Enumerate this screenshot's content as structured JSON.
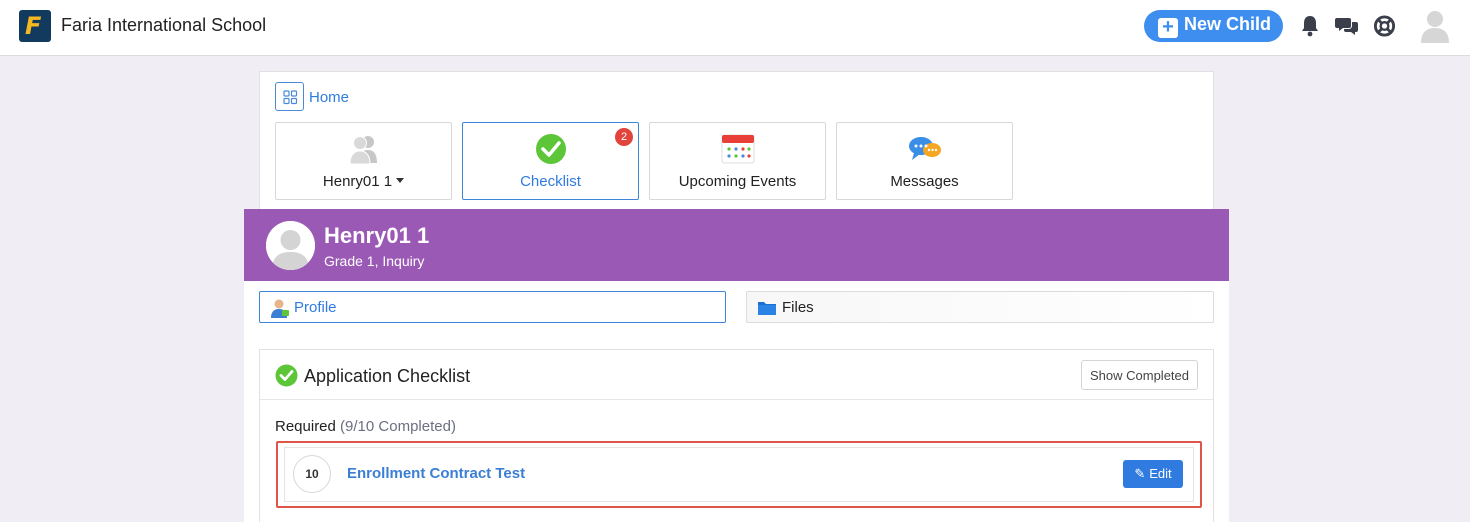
{
  "header": {
    "school_name": "Faria International School",
    "new_child_label": "New Child"
  },
  "home": {
    "link_label": "Home"
  },
  "tiles": [
    {
      "label": "Henry01 1",
      "icon": "users-icon"
    },
    {
      "label": "Checklist",
      "icon": "check-circle-icon",
      "badge": "2"
    },
    {
      "label": "Upcoming Events",
      "icon": "calendar-icon"
    },
    {
      "label": "Messages",
      "icon": "chat-bubbles-icon"
    }
  ],
  "child": {
    "name": "Henry01 1",
    "grade": "Grade 1, Inquiry"
  },
  "tabs": {
    "profile_label": "Profile",
    "files_label": "Files"
  },
  "checklist": {
    "title": "Application Checklist",
    "show_completed_label": "Show Completed",
    "required_label": "Required",
    "required_count": "(9/10 Completed)",
    "items": [
      {
        "number": "10",
        "title": "Enrollment Contract Test",
        "edit_label": "Edit"
      }
    ]
  },
  "colors": {
    "accent_blue": "#3e8ef0",
    "header_purple": "#9b59b6",
    "badge_red": "#e0443c",
    "highlight_red": "#e0554a",
    "check_green": "#5cc638"
  }
}
